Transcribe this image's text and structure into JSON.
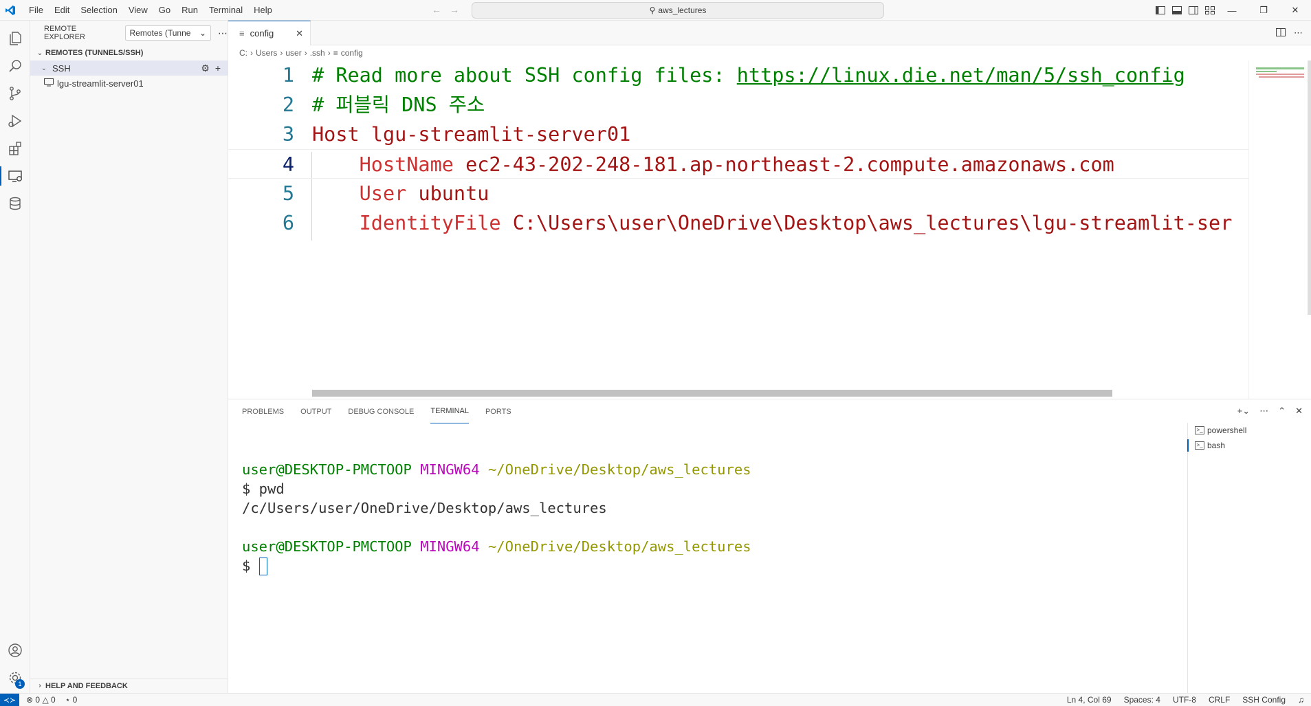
{
  "titlebar": {
    "menu": [
      "File",
      "Edit",
      "Selection",
      "View",
      "Go",
      "Run",
      "Terminal",
      "Help"
    ],
    "search_text": "aws_lectures"
  },
  "sidebar": {
    "title": "REMOTE EXPLORER",
    "dropdown_value": "Remotes (Tunne",
    "section_title": "REMOTES (TUNNELS/SSH)",
    "group_label": "SSH",
    "host_label": "lgu-streamlit-server01",
    "help_label": "HELP AND FEEDBACK"
  },
  "activity_badge": "1",
  "editor": {
    "tab_label": "config",
    "breadcrumb": [
      "C:",
      "Users",
      "user",
      ".ssh",
      "config"
    ],
    "lines": [
      {
        "num": "1",
        "parts": [
          {
            "t": "# Read more about SSH config files: ",
            "c": "c-comment"
          },
          {
            "t": "https://linux.die.net/man/5/ssh_config",
            "c": "c-link"
          }
        ]
      },
      {
        "num": "2",
        "parts": [
          {
            "t": "# 퍼블릭 DNS 주소",
            "c": "c-comment"
          }
        ]
      },
      {
        "num": "3",
        "parts": [
          {
            "t": "Host ",
            "c": "c-key2"
          },
          {
            "t": "lgu-streamlit-server01",
            "c": "c-val"
          }
        ]
      },
      {
        "num": "4",
        "parts": [
          {
            "t": "    HostName ",
            "c": "c-key"
          },
          {
            "t": "ec2-43-202-248-181.ap-northeast-2.compute.amazonaws.com",
            "c": "c-val"
          }
        ]
      },
      {
        "num": "5",
        "parts": [
          {
            "t": "    User ",
            "c": "c-key"
          },
          {
            "t": "ubuntu",
            "c": "c-val"
          }
        ]
      },
      {
        "num": "6",
        "parts": [
          {
            "t": "    IdentityFile ",
            "c": "c-key"
          },
          {
            "t": "C:\\Users\\user\\OneDrive\\Desktop\\aws_lectures\\lgu-streamlit-ser",
            "c": "c-val"
          }
        ]
      }
    ]
  },
  "panel": {
    "tabs": [
      "PROBLEMS",
      "OUTPUT",
      "DEBUG CONSOLE",
      "TERMINAL",
      "PORTS"
    ],
    "active_tab": "TERMINAL",
    "terminal_lines": [
      {
        "user": "user@DESKTOP-PMCTOOP",
        "env": "MINGW64",
        "path": "~/OneDrive/Desktop/aws_lectures"
      },
      {
        "cmd": "$ pwd"
      },
      {
        "out": "/c/Users/user/OneDrive/Desktop/aws_lectures"
      },
      {
        "blank": ""
      },
      {
        "user": "user@DESKTOP-PMCTOOP",
        "env": "MINGW64",
        "path": "~/OneDrive/Desktop/aws_lectures"
      },
      {
        "prompt": "$ "
      }
    ],
    "terminals": [
      "powershell",
      "bash"
    ]
  },
  "statusbar": {
    "errors": "0",
    "warnings": "0",
    "ports": "0",
    "position": "Ln 4, Col 69",
    "spaces": "Spaces: 4",
    "encoding": "UTF-8",
    "eol": "CRLF",
    "language": "SSH Config"
  },
  "colors": {
    "accent": "#005fb8",
    "comment": "#008000",
    "keyword": "#cd3131",
    "value": "#a31515",
    "terminal_magenta": "#bc05bc",
    "terminal_path": "#949800"
  }
}
